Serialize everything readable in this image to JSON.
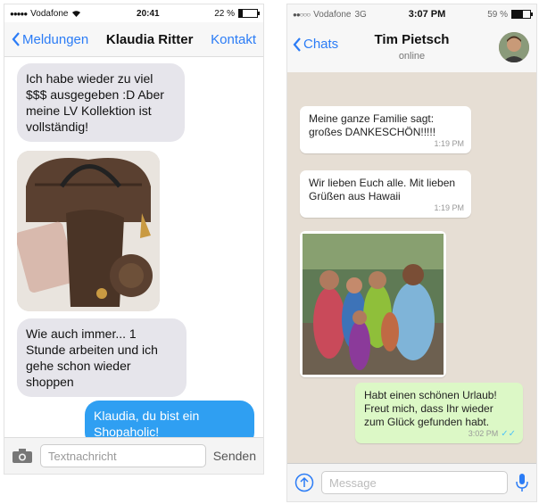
{
  "left": {
    "status": {
      "carrier": "Vodafone",
      "time": "20:41",
      "battery": "22 %",
      "battery_level": 0.22
    },
    "nav": {
      "back_label": "Meldungen",
      "title": "Klaudia Ritter",
      "right_label": "Kontakt"
    },
    "messages": [
      {
        "text": "Ich habe wieder zu viel $$$ ausgegeben :D Aber meine LV Kollektion ist vollständig!"
      },
      {
        "text": "Wie auch immer... 1 Stunde arbeiten und ich gehe schon wieder shoppen"
      },
      {
        "text": "Klaudia, du bist ein Shopaholic!"
      }
    ],
    "input": {
      "placeholder": "Textnachricht",
      "send_label": "Senden"
    }
  },
  "right": {
    "status": {
      "carrier": "Vodafone",
      "network": "3G",
      "time": "3:07 PM",
      "battery": "59 %",
      "battery_level": 0.59
    },
    "nav": {
      "back_label": "Chats",
      "title": "Tim Pietsch",
      "subtitle": "online"
    },
    "messages": [
      {
        "text": "Meine ganze Familie sagt: großes DANKESCHÖN!!!!!",
        "time": "1:19 PM"
      },
      {
        "text": "Wir lieben Euch alle. Mit lieben Grüßen aus Hawaii",
        "time": "1:19 PM"
      },
      {
        "text": "Habt einen schönen Urlaub! Freut mich, dass Ihr wieder zum Glück gefunden habt.",
        "time": "3:02 PM"
      }
    ],
    "input": {
      "placeholder": "Message"
    }
  }
}
